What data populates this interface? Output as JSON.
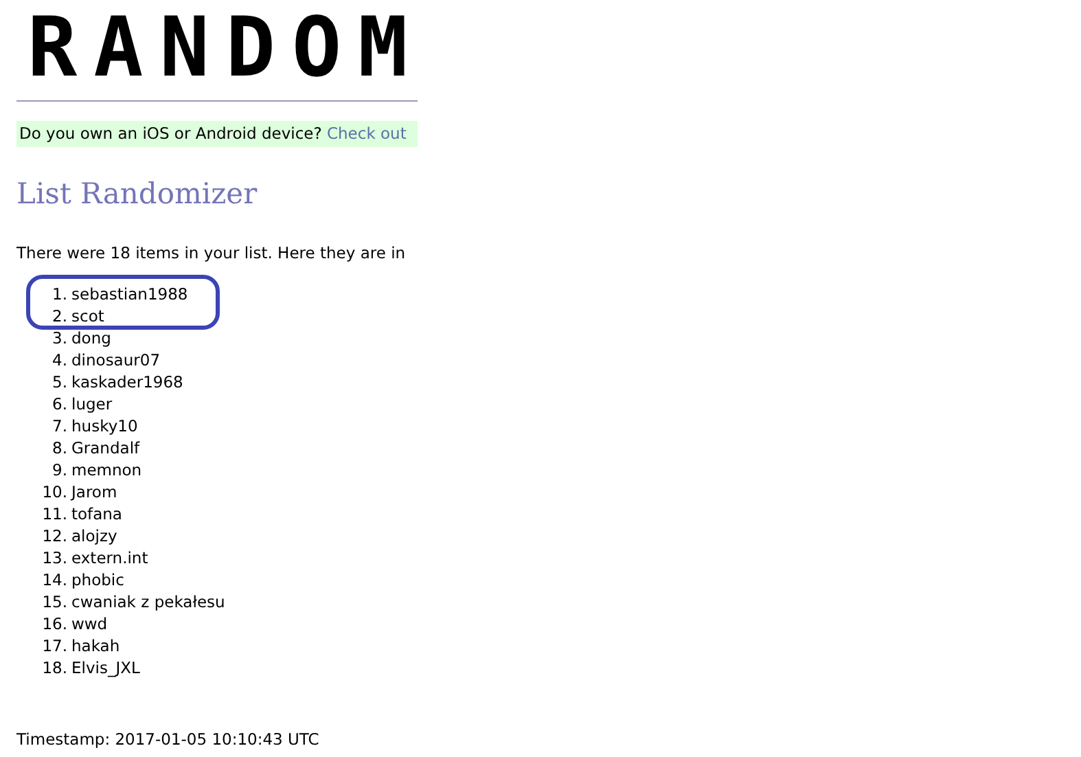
{
  "logo": "RANDOM",
  "notice": {
    "text": "Do you own an iOS or Android device?",
    "link": "Check out"
  },
  "heading": "List Randomizer",
  "summary": "There were 18 items in your list. Here they are in",
  "items": [
    {
      "number": "1.",
      "text": "sebastian1988",
      "circled": true
    },
    {
      "number": "2.",
      "text": "scot",
      "circled": true
    },
    {
      "number": "3.",
      "text": "dong",
      "circled": false
    },
    {
      "number": "4.",
      "text": "dinosaur07",
      "circled": false
    },
    {
      "number": "5.",
      "text": "kaskader1968",
      "circled": false
    },
    {
      "number": "6.",
      "text": "luger",
      "circled": false
    },
    {
      "number": "7.",
      "text": "husky10",
      "circled": false
    },
    {
      "number": "8.",
      "text": "Grandalf",
      "circled": false
    },
    {
      "number": "9.",
      "text": "memnon",
      "circled": false
    },
    {
      "number": "10.",
      "text": "Jarom",
      "circled": false
    },
    {
      "number": "11.",
      "text": "tofana",
      "circled": false
    },
    {
      "number": "12.",
      "text": "alojzy",
      "circled": false
    },
    {
      "number": "13.",
      "text": "extern.int",
      "circled": false
    },
    {
      "number": "14.",
      "text": "phobic",
      "circled": false
    },
    {
      "number": "15.",
      "text": "cwaniak z pekałesu",
      "circled": false
    },
    {
      "number": "16.",
      "text": "wwd",
      "circled": false
    },
    {
      "number": "17.",
      "text": "hakah",
      "circled": false
    },
    {
      "number": "18.",
      "text": "Elvis_JXL",
      "circled": false
    }
  ],
  "timestamp": "Timestamp: 2017-01-05 10:10:43 UTC"
}
